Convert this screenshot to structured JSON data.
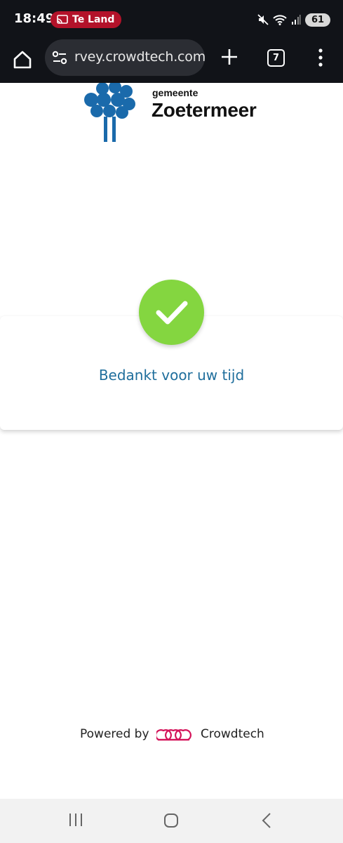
{
  "status_bar": {
    "time": "18:49",
    "cast_label": "Te Land",
    "battery_level": "61",
    "icons": [
      "cast-icon",
      "mute-icon",
      "wifi-icon",
      "signal-icon",
      "battery-icon"
    ]
  },
  "browser": {
    "url": "rvey.crowdtech.com",
    "tab_count": "7",
    "icons": [
      "home-icon",
      "site-settings-icon",
      "new-tab-icon",
      "tabs-icon",
      "menu-icon"
    ]
  },
  "logo": {
    "small_text": "gemeente",
    "big_text": "Zoetermeer",
    "color": "#1a6aab"
  },
  "confirmation": {
    "message": "Bedankt voor uw tijd",
    "check_color": "#84d640",
    "text_color": "#1f6e9c"
  },
  "footer": {
    "powered_by": "Powered by",
    "brand": "Crowdtech",
    "brand_color": "#d4145a"
  },
  "nav": {
    "icons": [
      "recents-icon",
      "home-nav-icon",
      "back-icon"
    ]
  }
}
